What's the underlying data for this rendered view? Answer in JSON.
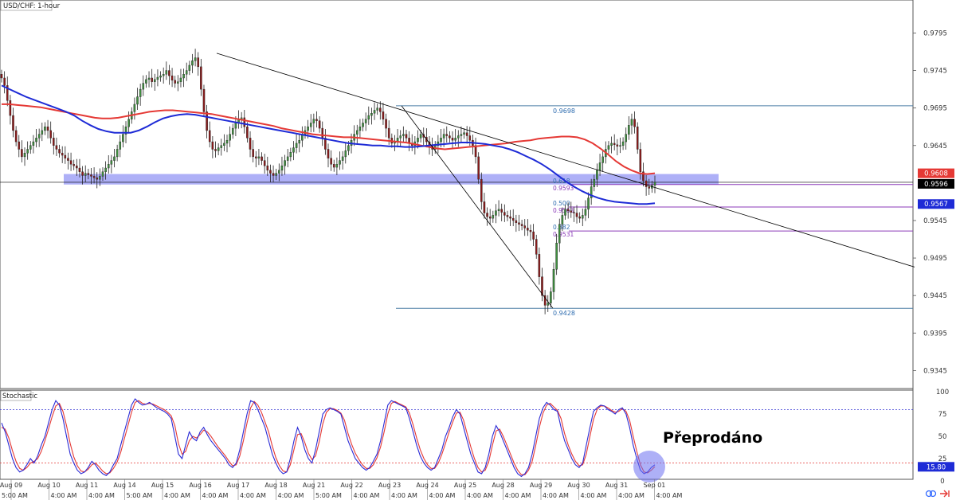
{
  "chart_data": {
    "type": "line",
    "title": "USD/CHF: 1-hour",
    "annotation": "Přeprodáno",
    "price_axis": {
      "ylim": [
        0.9321,
        0.9839
      ],
      "ticks": [
        "0.9795",
        "0.9745",
        "0.9695",
        "0.9645",
        "0.9545",
        "0.9495",
        "0.9445",
        "0.9395",
        "0.9345"
      ],
      "tick_values": [
        0.9795,
        0.9745,
        0.9695,
        0.9645,
        0.9545,
        0.9495,
        0.9445,
        0.9395,
        0.9345
      ]
    },
    "badges": [
      {
        "label": "0.9608",
        "value": 0.9608,
        "color": "#e53935",
        "text_color": "#ffffff"
      },
      {
        "label": "0.9596",
        "value": 0.9596,
        "color": "#000000",
        "text_color": "#ffffff"
      },
      {
        "label": "0.9567",
        "value": 0.9567,
        "color": "#1e2bd6",
        "text_color": "#ffffff"
      }
    ],
    "x_date_labels": [
      "Aug 09",
      "Aug 10",
      "Aug 11",
      "Aug 14",
      "Aug 15",
      "Aug 16",
      "Aug 17",
      "Aug 18",
      "Aug 21",
      "Aug 22",
      "Aug 23",
      "Aug 24",
      "Aug 25",
      "Aug 28",
      "Aug 29",
      "Aug 30",
      "Aug 31",
      "Sep 01"
    ],
    "x_time_labels": [
      "5:00 AM",
      "4:00 AM",
      "4:00 AM",
      "5:00 AM",
      "4:00 AM",
      "4:00 AM",
      "4:00 AM",
      "4:00 AM",
      "5:00 AM",
      "4:00 AM",
      "4:00 AM",
      "4:00 AM",
      "4:00 AM",
      "4:00 AM",
      "4:00 AM",
      "4:00 AM",
      "4:00 AM",
      "4:00 AM"
    ],
    "price_series": [
      {
        "values": [
          0.9735,
          0.9725,
          0.9705,
          0.9685,
          0.9665,
          0.965,
          0.964,
          0.963,
          0.9635,
          0.964,
          0.9645,
          0.965,
          0.9655,
          0.966,
          0.9665,
          0.967,
          0.9665,
          0.9655,
          0.9645,
          0.964,
          0.9635,
          0.9632,
          0.9628,
          0.9625,
          0.962,
          0.9618,
          0.9615,
          0.961,
          0.9605,
          0.9608,
          0.9606,
          0.9604,
          0.9602,
          0.96,
          0.9604,
          0.961,
          0.9615,
          0.962,
          0.9625,
          0.963,
          0.964,
          0.965,
          0.966,
          0.967,
          0.968,
          0.969,
          0.97,
          0.971,
          0.972,
          0.9728,
          0.9733,
          0.9735,
          0.973,
          0.9733,
          0.9736,
          0.9738,
          0.974,
          0.9745,
          0.9738,
          0.9732,
          0.9728,
          0.973,
          0.9735,
          0.974,
          0.9745,
          0.9752,
          0.9758,
          0.9762,
          0.975,
          0.972,
          0.969,
          0.9665,
          0.965,
          0.964,
          0.9638,
          0.9642,
          0.9645,
          0.9648,
          0.9652,
          0.966,
          0.9668,
          0.9675,
          0.968,
          0.9682,
          0.967,
          0.9655,
          0.964,
          0.963,
          0.9628,
          0.963,
          0.9625,
          0.9618,
          0.9612,
          0.9608,
          0.9605,
          0.9608,
          0.9612,
          0.9618,
          0.9625,
          0.963,
          0.9636,
          0.9642,
          0.9648,
          0.9652,
          0.966,
          0.9665,
          0.967,
          0.9675,
          0.968,
          0.9678,
          0.9668,
          0.9655,
          0.964,
          0.9628,
          0.962,
          0.9616,
          0.962,
          0.9625,
          0.963,
          0.9638,
          0.9645,
          0.9652,
          0.966,
          0.9665,
          0.967,
          0.9675,
          0.968,
          0.9685,
          0.9688,
          0.9692,
          0.9695,
          0.969,
          0.968,
          0.9668,
          0.9655,
          0.9648,
          0.965,
          0.9655,
          0.9658,
          0.966,
          0.9655,
          0.9648,
          0.9645,
          0.965,
          0.9655,
          0.966,
          0.9656,
          0.965,
          0.9645,
          0.964,
          0.9645,
          0.965,
          0.9655,
          0.966,
          0.9658,
          0.9655,
          0.9652,
          0.9655,
          0.9658,
          0.966,
          0.9662,
          0.9658,
          0.9652,
          0.9645,
          0.963,
          0.96,
          0.957,
          0.9555,
          0.955,
          0.9548,
          0.9552,
          0.9558,
          0.956,
          0.9556,
          0.9552,
          0.955,
          0.9548,
          0.9545,
          0.9542,
          0.954,
          0.9538,
          0.9535,
          0.9532,
          0.953,
          0.952,
          0.95,
          0.947,
          0.9445,
          0.9432,
          0.9435,
          0.945,
          0.948,
          0.9515,
          0.954,
          0.9552,
          0.956,
          0.9558,
          0.9556,
          0.9555,
          0.955,
          0.9548,
          0.9552,
          0.956,
          0.9575,
          0.959,
          0.96,
          0.9612,
          0.9622,
          0.963,
          0.964,
          0.9645,
          0.9648,
          0.9646,
          0.9644,
          0.9645,
          0.965,
          0.966,
          0.9672,
          0.968,
          0.967,
          0.964,
          0.961,
          0.9598,
          0.959,
          0.9588,
          0.9592,
          0.9596
        ]
      },
      {
        "name": "red",
        "color": "#e53935",
        "values": [
          0.97,
          0.97,
          0.9699,
          0.9698,
          0.9697,
          0.9696,
          0.9694,
          0.9692,
          0.969,
          0.9688,
          0.9686,
          0.9684,
          0.9682,
          0.9681,
          0.9681,
          0.9682,
          0.9684,
          0.9686,
          0.9688,
          0.969,
          0.9691,
          0.9692,
          0.9692,
          0.9691,
          0.969,
          0.9689,
          0.9688,
          0.9687,
          0.9685,
          0.9683,
          0.9681,
          0.9679,
          0.9677,
          0.9675,
          0.9673,
          0.9671,
          0.9668,
          0.9666,
          0.9664,
          0.9662,
          0.966,
          0.9659,
          0.9658,
          0.9657,
          0.9656,
          0.9656,
          0.9655,
          0.9654,
          0.9653,
          0.9652,
          0.9651,
          0.965,
          0.9649,
          0.9647,
          0.9645,
          0.9643,
          0.9641,
          0.964,
          0.9641,
          0.9642,
          0.9643,
          0.9644,
          0.9645,
          0.9646,
          0.9647,
          0.9648,
          0.965,
          0.9651,
          0.9652,
          0.9654,
          0.9655,
          0.9656,
          0.9657,
          0.9657,
          0.9656,
          0.9653,
          0.9648,
          0.9641,
          0.9633,
          0.9624,
          0.9617,
          0.9612,
          0.9608,
          0.9607,
          0.9608
        ]
      },
      {
        "name": "blue",
        "color": "#1e2bd6",
        "values": [
          0.9725,
          0.972,
          0.9715,
          0.971,
          0.9706,
          0.9702,
          0.9698,
          0.9694,
          0.969,
          0.9685,
          0.9678,
          0.9672,
          0.9667,
          0.9664,
          0.9662,
          0.9662,
          0.9662,
          0.9665,
          0.967,
          0.9676,
          0.9681,
          0.9684,
          0.9686,
          0.9687,
          0.9686,
          0.9684,
          0.9682,
          0.968,
          0.9678,
          0.9676,
          0.9674,
          0.9672,
          0.967,
          0.9668,
          0.9666,
          0.9664,
          0.9662,
          0.966,
          0.9658,
          0.9656,
          0.9654,
          0.9652,
          0.965,
          0.9648,
          0.9647,
          0.9646,
          0.9645,
          0.9645,
          0.9644,
          0.9644,
          0.9643,
          0.9643,
          0.9644,
          0.9645,
          0.9646,
          0.9647,
          0.9648,
          0.9649,
          0.9649,
          0.9648,
          0.9647,
          0.9645,
          0.9643,
          0.964,
          0.9636,
          0.9631,
          0.9626,
          0.962,
          0.9613,
          0.9605,
          0.9597,
          0.959,
          0.9584,
          0.9579,
          0.9575,
          0.9572,
          0.957,
          0.9569,
          0.9568,
          0.9567,
          0.9567,
          0.9568
        ]
      }
    ],
    "support_zone": {
      "low": 0.9593,
      "high": 0.9607
    },
    "fibonacci": {
      "high": "0.9698",
      "low": "0.9428",
      "levels": [
        {
          "ratio": "0.618",
          "price": "0.9593",
          "value": 0.9593
        },
        {
          "ratio": "0.500",
          "price": "0.9563",
          "value": 0.9563
        },
        {
          "ratio": "0.382",
          "price": "0.9531",
          "value": 0.9531
        }
      ]
    },
    "stochastic": {
      "title": "Stochastic",
      "ylim": [
        0,
        100
      ],
      "ticks": [
        "100",
        "75",
        "50",
        "25",
        "0"
      ],
      "tick_values": [
        100,
        75,
        50,
        25,
        0
      ],
      "overbought": 80,
      "oversold": 20,
      "badge": "15.80",
      "badge_value": 15.8,
      "k": [
        65,
        55,
        40,
        25,
        15,
        10,
        12,
        18,
        25,
        20,
        28,
        40,
        50,
        65,
        80,
        90,
        85,
        70,
        50,
        30,
        20,
        12,
        8,
        10,
        15,
        22,
        18,
        12,
        8,
        6,
        10,
        18,
        25,
        40,
        55,
        70,
        85,
        92,
        88,
        85,
        86,
        88,
        85,
        82,
        80,
        78,
        75,
        70,
        50,
        30,
        25,
        40,
        55,
        48,
        45,
        55,
        60,
        52,
        45,
        40,
        35,
        30,
        25,
        18,
        15,
        20,
        35,
        55,
        75,
        90,
        88,
        80,
        70,
        60,
        45,
        30,
        20,
        12,
        8,
        10,
        25,
        45,
        60,
        50,
        35,
        25,
        20,
        35,
        55,
        75,
        80,
        82,
        80,
        78,
        75,
        60,
        45,
        35,
        25,
        20,
        15,
        12,
        15,
        22,
        30,
        45,
        65,
        85,
        90,
        88,
        86,
        84,
        82,
        70,
        55,
        40,
        28,
        20,
        15,
        12,
        15,
        25,
        35,
        50,
        60,
        72,
        80,
        75,
        60,
        45,
        30,
        20,
        10,
        8,
        15,
        30,
        50,
        62,
        55,
        45,
        35,
        25,
        15,
        8,
        5,
        8,
        15,
        30,
        50,
        70,
        82,
        88,
        85,
        80,
        78,
        60,
        45,
        35,
        25,
        18,
        15,
        20,
        40,
        60,
        78,
        82,
        85,
        84,
        80,
        78,
        75,
        80,
        82,
        75,
        60,
        40,
        25,
        12,
        8,
        10,
        15,
        18
      ],
      "d": [
        60,
        58,
        48,
        34,
        22,
        14,
        12,
        15,
        20,
        22,
        25,
        33,
        45,
        58,
        72,
        84,
        87,
        78,
        62,
        42,
        27,
        17,
        11,
        10,
        13,
        18,
        20,
        16,
        11,
        8,
        9,
        14,
        21,
        32,
        47,
        62,
        77,
        88,
        90,
        87,
        86,
        87,
        86,
        84,
        82,
        80,
        77,
        73,
        62,
        42,
        30,
        33,
        45,
        50,
        48,
        52,
        57,
        55,
        50,
        44,
        38,
        33,
        28,
        22,
        17,
        18,
        28,
        45,
        65,
        82,
        89,
        85,
        77,
        66,
        55,
        39,
        26,
        17,
        11,
        10,
        18,
        35,
        52,
        53,
        43,
        31,
        24,
        28,
        44,
        64,
        77,
        81,
        81,
        79,
        76,
        68,
        53,
        41,
        31,
        24,
        18,
        14,
        14,
        18,
        26,
        38,
        55,
        75,
        87,
        89,
        87,
        85,
        83,
        76,
        63,
        48,
        35,
        25,
        18,
        14,
        14,
        20,
        30,
        42,
        55,
        66,
        76,
        77,
        68,
        53,
        38,
        25,
        15,
        10,
        12,
        22,
        40,
        56,
        58,
        50,
        40,
        30,
        20,
        12,
        7,
        7,
        12,
        22,
        40,
        60,
        76,
        85,
        87,
        83,
        79,
        70,
        53,
        40,
        30,
        22,
        17,
        18,
        30,
        50,
        69,
        80,
        84,
        84,
        82,
        79,
        77,
        78,
        81,
        78,
        68,
        50,
        33,
        18,
        10,
        9,
        12,
        16
      ]
    }
  },
  "toolbar": {
    "link_icon": "link-icon",
    "arrow_icon": "arrow-icon"
  },
  "colors": {
    "up": "#3f8f3f",
    "down": "#8b1a1a",
    "fib": "#8b3ab8",
    "zone": "#6b6ff0",
    "trend": "#000000"
  }
}
